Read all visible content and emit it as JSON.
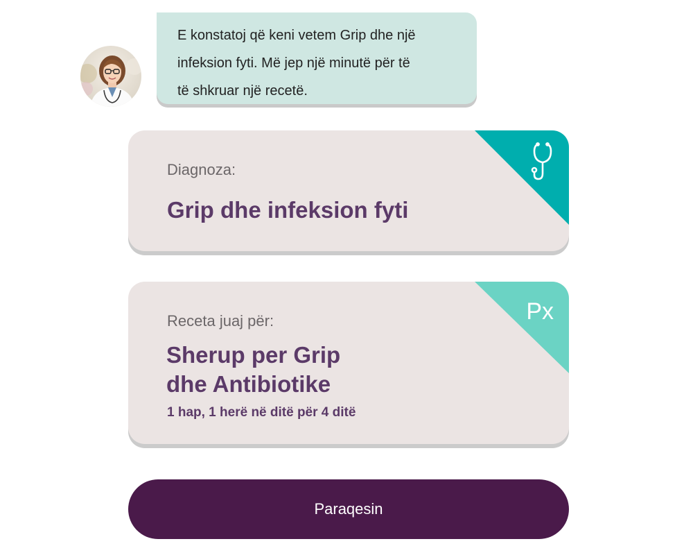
{
  "chat": {
    "message": "E konstatoj që keni vetem Grip dhe një\ninfeksion fyti. Më jep një minutë për të\ntë shkruar një recetë.",
    "avatar_icon": "doctor-avatar"
  },
  "diagnosis": {
    "label": "Diagnoza:",
    "value": "Grip dhe infeksion fyti",
    "corner_icon": "stethoscope-icon",
    "accent_color": "#00aeae"
  },
  "prescription": {
    "label": "Receta juaj për:",
    "title_line1": "Sherup per Grip",
    "title_line2": "dhe Antibiotike",
    "dosage": "1 hap, 1 herë në ditë për 4 ditë",
    "corner_text": "Px",
    "accent_color": "#6bd3c4"
  },
  "actions": {
    "submit_label": "Paraqesin",
    "submit_color": "#4a1a4a"
  }
}
